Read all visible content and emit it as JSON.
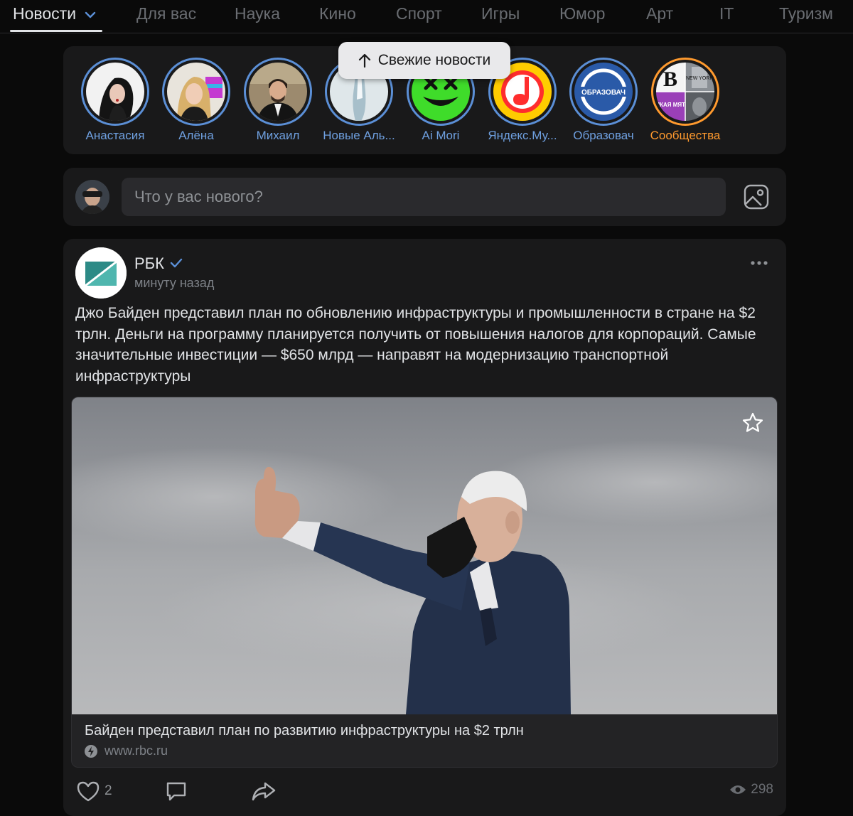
{
  "tabs": [
    {
      "label": "Новости",
      "active": true
    },
    {
      "label": "Для вас"
    },
    {
      "label": "Наука"
    },
    {
      "label": "Кино"
    },
    {
      "label": "Спорт"
    },
    {
      "label": "Игры"
    },
    {
      "label": "Юмор"
    },
    {
      "label": "Арт"
    },
    {
      "label": "IT"
    },
    {
      "label": "Туризм"
    }
  ],
  "fresh_news": "Свежие новости",
  "stories": [
    {
      "name": "Анастасия"
    },
    {
      "name": "Алёна"
    },
    {
      "name": "Михаил"
    },
    {
      "name": "Новые Аль..."
    },
    {
      "name": "Ai Mori"
    },
    {
      "name": "Яндекс.Му..."
    },
    {
      "name": "Образовач",
      "logo_text": "ОБРАЗОВАЧ"
    },
    {
      "name": "Сообщества",
      "tile_b": "B",
      "tile_ny": "NEW YORK",
      "tile_mint": "ДИКАЯ МЯТА"
    }
  ],
  "composer": {
    "placeholder": "Что у вас нового?"
  },
  "post": {
    "author": "РБК",
    "time": "минуту назад",
    "text": "Джо Байден представил план по обновлению инфраструктуры и промышленности в стране на $2 трлн. Деньги на программу планируется получить от повышения налогов для корпораций. Самые значительные инвестиции — $650 млрд — направят на модернизацию транспортной инфраструктуры",
    "link_title": "Байден представил план по развитию инфраструктуры на $2 трлн",
    "link_domain": "www.rbc.ru",
    "likes": "2",
    "views": "298"
  },
  "colors": {
    "background": "#0a0a0a",
    "card": "#19191a",
    "accent_blue": "#6fa0e0",
    "accent_orange": "#ff9a2e"
  }
}
